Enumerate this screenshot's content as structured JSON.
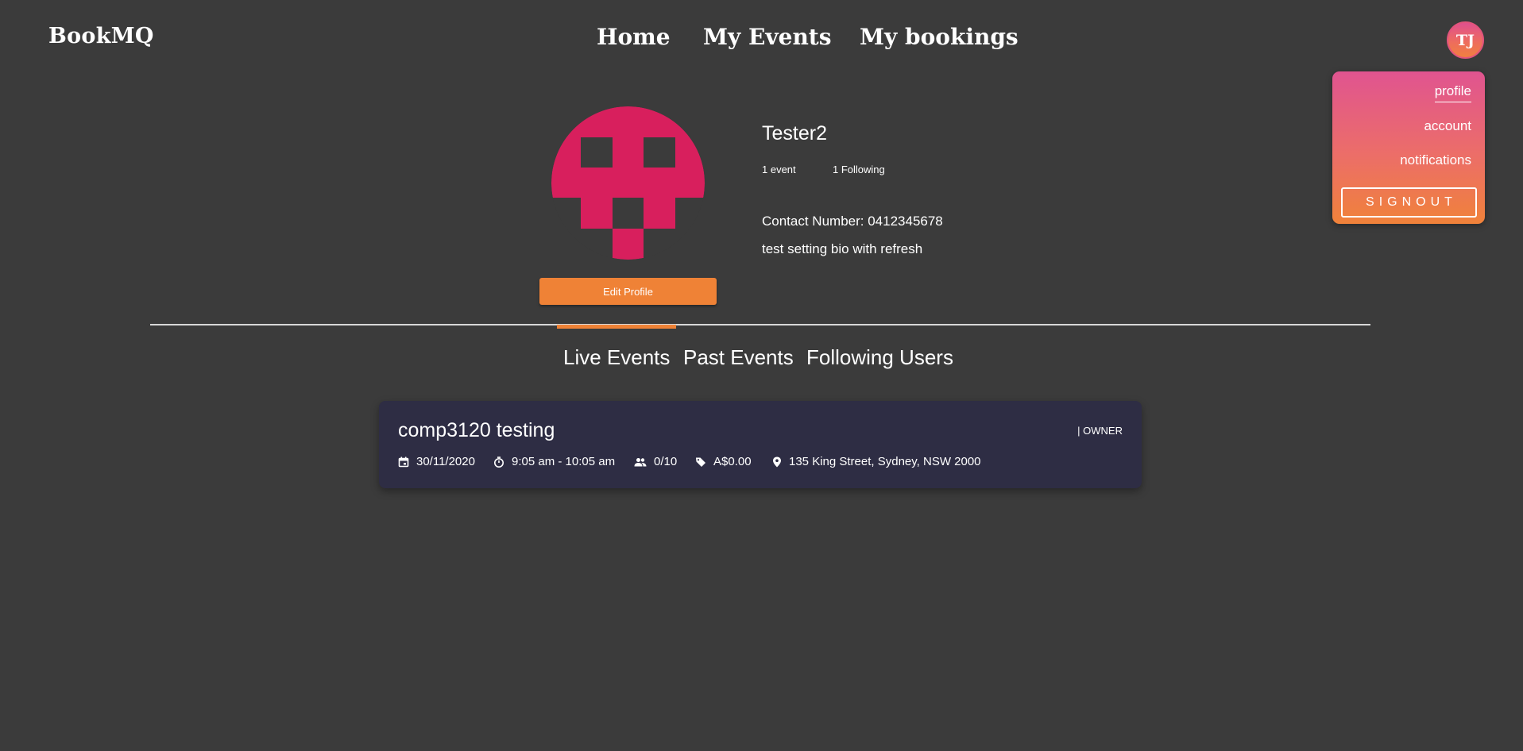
{
  "app": {
    "brand": "BookMQ"
  },
  "nav": {
    "home": "Home",
    "my_events": "My Events",
    "my_bookings": "My bookings"
  },
  "user_menu": {
    "initials": "TJ",
    "items": {
      "profile": "profile",
      "account": "account",
      "notifications": "notifications"
    },
    "signout": "SIGNOUT"
  },
  "profile": {
    "username": "Tester2",
    "events_count": "1 event",
    "following_count": "1 Following",
    "contact": "Contact Number: 0412345678",
    "bio": "test setting bio with refresh",
    "edit_button": "Edit Profile"
  },
  "tabs": {
    "live": "Live Events",
    "past": "Past Events",
    "following": "Following Users",
    "active": "live"
  },
  "events": [
    {
      "title": "comp3120 testing",
      "role": "| OWNER",
      "date": "30/11/2020",
      "time": "9:05 am - 10:05 am",
      "capacity": "0/10",
      "price": "A$0.00",
      "location": "135 King Street, Sydney, NSW 2000",
      "icons": [
        "calendar-icon",
        "timer-icon",
        "people-icon",
        "tag-icon",
        "location-pin-icon"
      ]
    }
  ],
  "colors": {
    "background": "#3b3b3b",
    "accent": "#ef8236",
    "avatar": "#d81f5d",
    "card": "#2e2d44",
    "menu_gradient_top": "#e05490",
    "menu_gradient_bottom": "#f0823a"
  }
}
